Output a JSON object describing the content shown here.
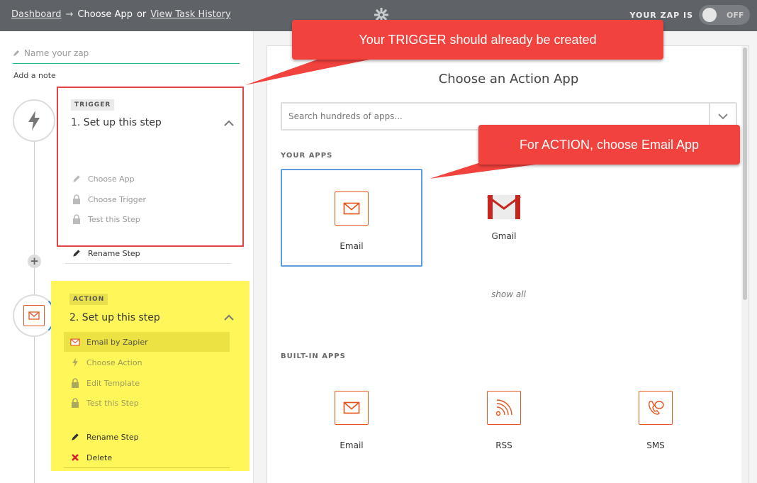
{
  "topbar": {
    "dashboard": "Dashboard",
    "arrow": "→",
    "current": "Choose App",
    "or": "or",
    "history": "View Task History",
    "zap_is": "YOUR ZAP IS",
    "toggle_state": "OFF"
  },
  "sidebar": {
    "name_placeholder": "Name your zap",
    "add_note": "Add a note",
    "trigger": {
      "tag": "TRIGGER",
      "title": "1. Set up this step",
      "items": [
        "Choose App",
        "Choose Trigger",
        "Test this Step"
      ],
      "rename": "Rename Step"
    },
    "action": {
      "tag": "ACTION",
      "title": "2. Set up this step",
      "items": [
        "Email by Zapier",
        "Choose Action",
        "Edit Template",
        "Test this Step"
      ],
      "rename": "Rename Step",
      "delete": "Delete"
    }
  },
  "main": {
    "heading": "Choose an Action App",
    "search_placeholder": "Search hundreds of apps...",
    "your_apps_label": "YOUR APPS",
    "your_apps": [
      "Email",
      "Gmail"
    ],
    "show_all": "show all",
    "builtin_label": "BUILT-IN APPS",
    "builtin_apps": [
      "Email",
      "RSS",
      "SMS"
    ]
  },
  "callouts": {
    "trigger": "Your TRIGGER should already be created",
    "action": "For ACTION, choose Email App"
  },
  "colors": {
    "accent_orange": "#e8541e",
    "callout_red": "#f2423e",
    "highlight_yellow": "#fff65a",
    "selected_blue": "#5c9ddc"
  }
}
